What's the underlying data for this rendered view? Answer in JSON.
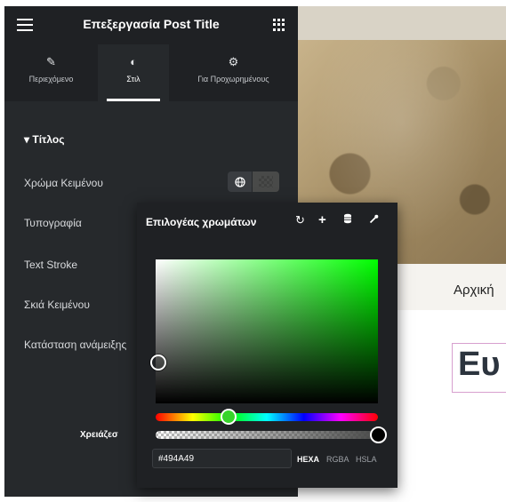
{
  "header": {
    "title": "Επεξεργασία Post Title",
    "menu_icon": "hamburger-icon",
    "apps_icon": "grid-icon"
  },
  "tabs": [
    {
      "label": "Περιεχόμενο",
      "icon": "pencil-icon",
      "active": false
    },
    {
      "label": "Στιλ",
      "icon": "half-circle-icon",
      "active": true
    },
    {
      "label": "Για Προχωρημένους",
      "icon": "gear-icon",
      "active": false
    }
  ],
  "section": {
    "label": "Τίτλος",
    "expanded": true
  },
  "controls": {
    "text_color": "Χρώμα Κειμένου",
    "typography": "Τυπογραφία",
    "text_stroke": "Text Stroke",
    "text_shadow": "Σκιά Κειμένου",
    "blend_mode": "Κατάσταση ανάμειξης"
  },
  "help_text": "Χρειάζεσ",
  "picker": {
    "title": "Επιλογέας χρωμάτων",
    "hex_value": "#494A49",
    "modes": [
      "HEXA",
      "RGBA",
      "HSLA"
    ],
    "active_mode": "HEXA",
    "hue_color": "#00ff00",
    "selected_color": "#494A49",
    "saturation": 0.02,
    "value": 0.29,
    "hue": 120,
    "opacity": 1
  },
  "preview": {
    "nav_item": "Αρχική",
    "heading": "Ευ"
  },
  "colors": {
    "panel_bg": "#26292c",
    "header_bg": "#1f2124",
    "heading_border": "#d7a0cf"
  }
}
